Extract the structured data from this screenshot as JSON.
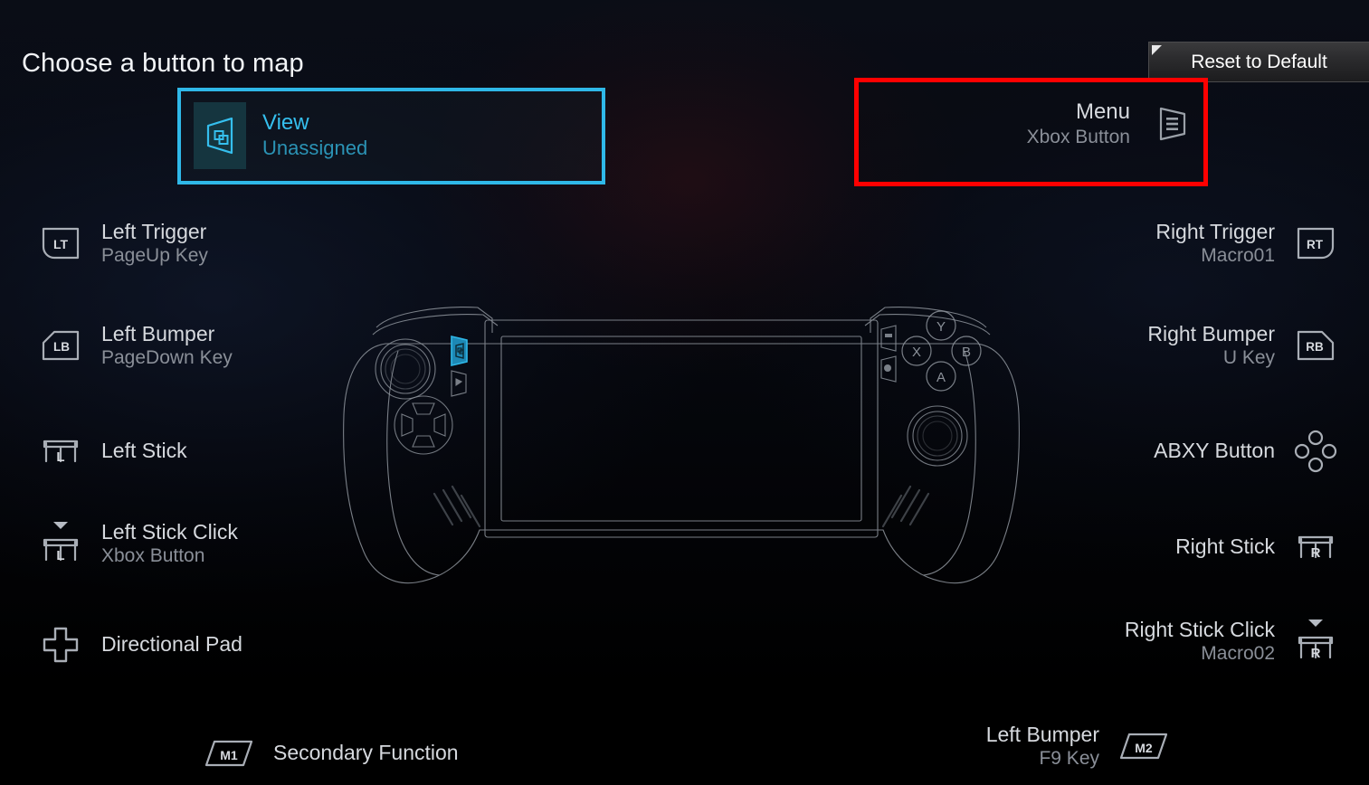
{
  "page_title": "Choose a button to map",
  "toolbar": {
    "reset_label": "Reset to Default"
  },
  "selected": {
    "view": {
      "title": "View",
      "subtitle": "Unassigned",
      "icon": "view-button-icon",
      "highlight_color": "#2fb8e8"
    },
    "menu": {
      "title": "Menu",
      "subtitle": "Xbox Button",
      "icon": "menu-button-icon",
      "highlight_color": "#ff0000"
    }
  },
  "left_column": [
    {
      "title": "Left Trigger",
      "subtitle": "PageUp Key",
      "icon": "lt-trigger-icon",
      "icon_label": "LT"
    },
    {
      "title": "Left Bumper",
      "subtitle": "PageDown Key",
      "icon": "lb-bumper-icon",
      "icon_label": "LB"
    },
    {
      "title": "Left Stick",
      "subtitle": "",
      "icon": "left-stick-icon",
      "icon_label": "L"
    },
    {
      "title": "Left Stick Click",
      "subtitle": "Xbox Button",
      "icon": "left-stick-click-icon",
      "icon_label": "L"
    },
    {
      "title": "Directional Pad",
      "subtitle": "",
      "icon": "dpad-icon",
      "icon_label": ""
    }
  ],
  "right_column": [
    {
      "title": "Right Trigger",
      "subtitle": "Macro01",
      "icon": "rt-trigger-icon",
      "icon_label": "RT"
    },
    {
      "title": "Right Bumper",
      "subtitle": "U Key",
      "icon": "rb-bumper-icon",
      "icon_label": "RB"
    },
    {
      "title": "ABXY Button",
      "subtitle": "",
      "icon": "abxy-icon",
      "icon_label": ""
    },
    {
      "title": "Right Stick",
      "subtitle": "",
      "icon": "right-stick-icon",
      "icon_label": "R"
    },
    {
      "title": "Right Stick Click",
      "subtitle": "Macro02",
      "icon": "right-stick-click-icon",
      "icon_label": "R"
    }
  ],
  "bottom_left": {
    "title": "Secondary Function",
    "subtitle": "",
    "icon": "m1-macro-icon",
    "icon_label": "M1"
  },
  "bottom_right": {
    "title": "Left Bumper",
    "subtitle": "F9 Key",
    "icon": "m2-macro-icon",
    "icon_label": "M2"
  },
  "device": {
    "face_buttons": [
      "Y",
      "X",
      "B",
      "A"
    ],
    "accent_color": "#2fb8e8"
  },
  "colors": {
    "background": "#000000",
    "title_text": "#f2f4f7",
    "label_text": "#d6d9de",
    "sub_text": "#8a8f98",
    "accent_cyan": "#2fb8e8",
    "accent_red": "#ff0000"
  }
}
